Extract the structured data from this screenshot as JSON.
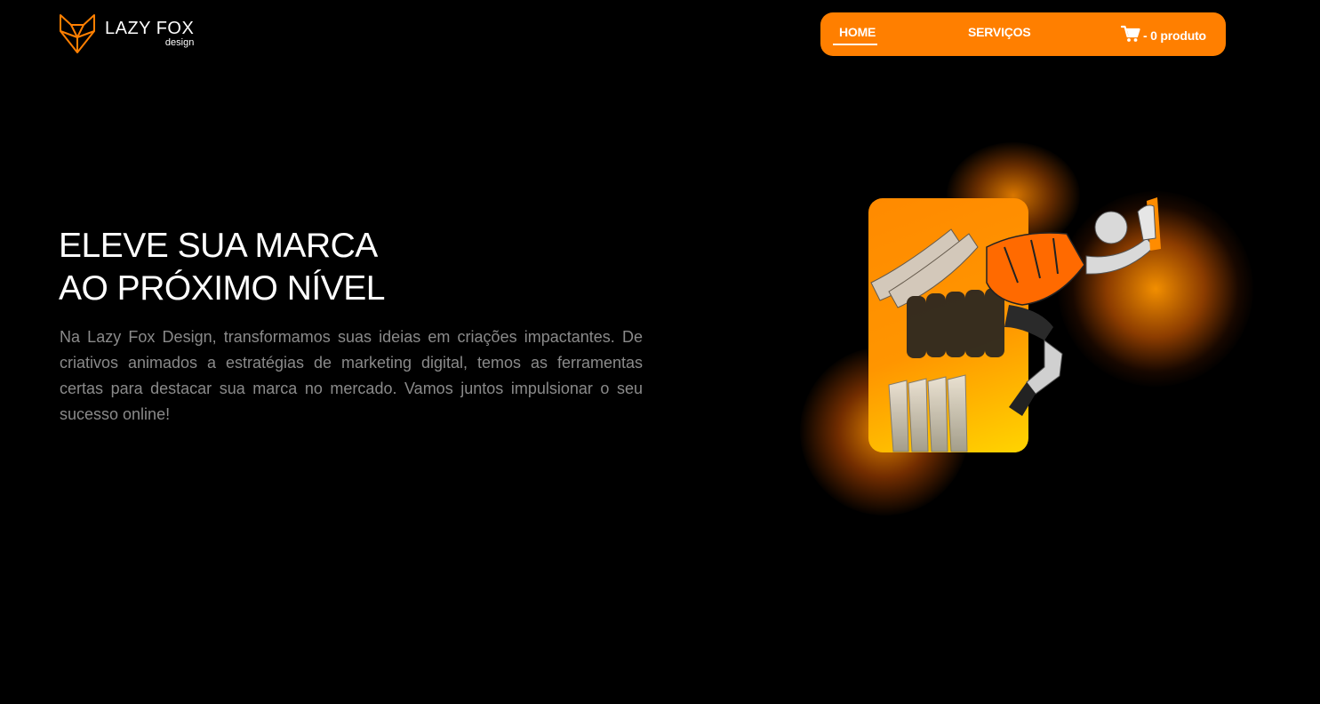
{
  "brand": {
    "name": "LAZY FOX",
    "sub": "design",
    "accent_color": "#ff7f00",
    "logo_icon": "fox-head-icon"
  },
  "nav": {
    "home": "HOME",
    "services": "SERVIÇOS",
    "cart_icon": "cart-icon",
    "cart_label": "- 0 produto"
  },
  "hero": {
    "title_line1": "ELEVE SUA MARCA",
    "title_line2": "AO PRÓXIMO NÍVEL",
    "description": "Na Lazy Fox Design, transformamos suas ideias em criações impactantes. De criativos animados a estratégias de marketing digital, temos as ferramentas certas para destacar sua marca no mercado. Vamos juntos impulsionar o seu sucesso online!"
  }
}
